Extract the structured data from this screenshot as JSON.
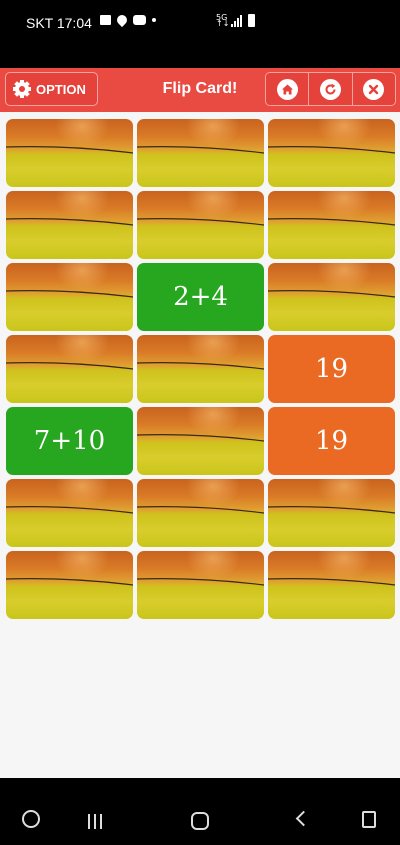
{
  "status_bar": {
    "time": "SKT 17:04",
    "icons_left": [
      "image-icon",
      "pin-icon",
      "youtube-icon",
      "dot-icon"
    ],
    "icons_right": [
      "data-5g-icon",
      "signal-icon",
      "battery-icon"
    ]
  },
  "header": {
    "option_label": "OPTION",
    "title": "Flip Card!",
    "controls": [
      "home-icon",
      "refresh-icon",
      "close-icon"
    ]
  },
  "board": {
    "columns": 3,
    "rows": 7,
    "cards": [
      {
        "state": "back"
      },
      {
        "state": "back"
      },
      {
        "state": "back"
      },
      {
        "state": "back"
      },
      {
        "state": "back"
      },
      {
        "state": "back"
      },
      {
        "state": "back"
      },
      {
        "state": "face",
        "text": "2+4",
        "color": "#26a71f"
      },
      {
        "state": "back"
      },
      {
        "state": "back"
      },
      {
        "state": "back"
      },
      {
        "state": "face",
        "text": "19",
        "color": "#ea6a24"
      },
      {
        "state": "face",
        "text": "7+10",
        "color": "#26a71f"
      },
      {
        "state": "back"
      },
      {
        "state": "face",
        "text": "19",
        "color": "#ea6a24"
      },
      {
        "state": "back"
      },
      {
        "state": "back"
      },
      {
        "state": "back"
      },
      {
        "state": "back"
      },
      {
        "state": "back"
      },
      {
        "state": "back"
      }
    ]
  },
  "colors": {
    "header_red": "#e94b43",
    "question_green": "#26a71f",
    "answer_orange": "#ea6a24",
    "board_bg": "#f6f6f6"
  },
  "navigation_bar": [
    "game-icon",
    "recents-icon",
    "home-icon",
    "back-icon",
    "screenshot-icon"
  ]
}
